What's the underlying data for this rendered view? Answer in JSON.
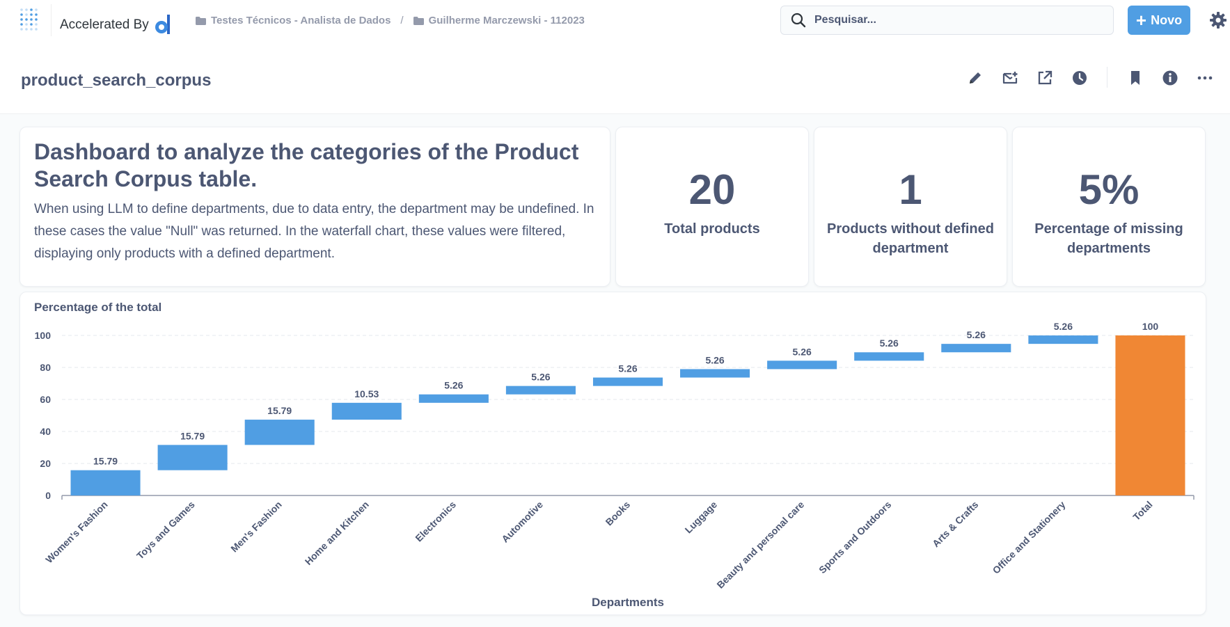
{
  "nav": {
    "brand": "Accelerated By",
    "breadcrumb": [
      "Testes Técnicos - Analista de Dados",
      "Guilherme Marczewski - 112023"
    ],
    "crumb_separator": "/",
    "search_placeholder": "Pesquisar...",
    "new_button": "Novo",
    "plus_glyph": "+",
    "accent": "#509ee3"
  },
  "header": {
    "title": "product_search_corpus",
    "icons": [
      "pencil-icon",
      "subscription-icon",
      "share-icon",
      "history-icon",
      "bookmark-icon",
      "info-icon",
      "more-icon"
    ]
  },
  "text_card": {
    "heading": "Dashboard to analyze the categories of the Product Search Corpus table.",
    "body": "When using LLM to define departments, due to data entry, the department may be undefined. In these cases the value \"Null\" was returned. In the waterfall chart, these values were filtered, displaying only products with a defined department."
  },
  "stats": [
    {
      "value": "20",
      "label": "Total products"
    },
    {
      "value": "1",
      "label": "Products without defined department"
    },
    {
      "value": "5%",
      "label": "Percentage of missing departments"
    }
  ],
  "chart_data": {
    "type": "waterfall",
    "title": "Percentage of the total",
    "xlabel": "Departments",
    "ylabel": "",
    "ylim": [
      0,
      100
    ],
    "yticks": [
      0,
      20,
      40,
      60,
      80,
      100
    ],
    "grid": true,
    "categories": [
      "Women's Fashion",
      "Toys and Games",
      "Men's Fashion",
      "Home and Kitchen",
      "Electronics",
      "Automotive",
      "Books",
      "Luggage",
      "Beauty and personal care",
      "Sports and Outdoors",
      "Arts & Crafts",
      "Office and Stationery",
      "Total"
    ],
    "values": [
      15.79,
      15.79,
      15.79,
      10.53,
      5.26,
      5.26,
      5.26,
      5.26,
      5.26,
      5.26,
      5.26,
      5.26,
      100
    ],
    "labels": [
      "15.79",
      "15.79",
      "15.79",
      "10.53",
      "5.26",
      "5.26",
      "5.26",
      "5.26",
      "5.26",
      "5.26",
      "5.26",
      "5.26",
      "100"
    ],
    "increase_color": "#509ee3",
    "total_color": "#f08734"
  }
}
